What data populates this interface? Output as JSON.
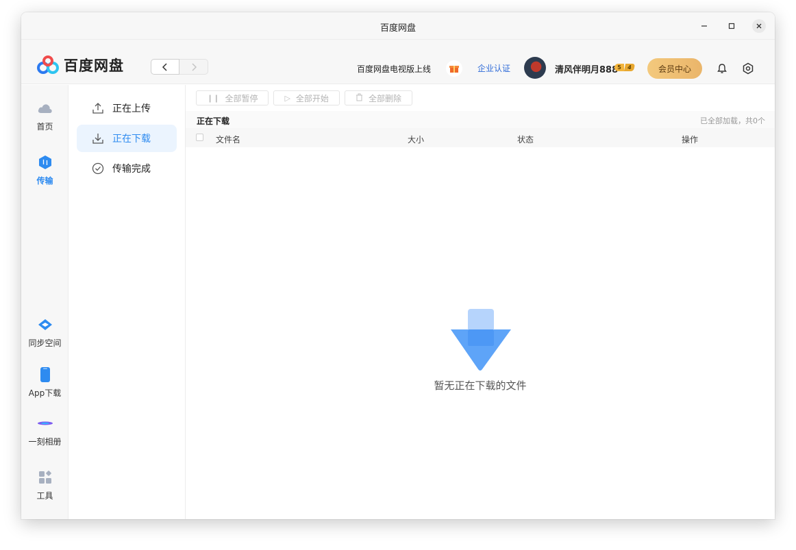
{
  "window": {
    "title": "百度网盘"
  },
  "app": {
    "name": "百度网盘"
  },
  "header": {
    "promo": "百度网盘电视版上线",
    "enterprise": "企业认证",
    "username": "清风伴明月888",
    "level_badge": [
      "5",
      "4"
    ],
    "vip_label": "会员中心"
  },
  "leftnav": {
    "home": "首页",
    "transfer": "传输",
    "sync": "同步空间",
    "app_download": "App下载",
    "album": "一刻相册",
    "tools": "工具"
  },
  "subnav": {
    "uploading": "正在上传",
    "downloading": "正在下载",
    "completed": "传输完成"
  },
  "toolbar": {
    "pause_all": "全部暂停",
    "start_all": "全部开始",
    "delete_all": "全部删除"
  },
  "section": {
    "title": "正在下载",
    "count": "已全部加载，共0个"
  },
  "table": {
    "columns": [
      "文件名",
      "大小",
      "状态",
      "操作"
    ]
  },
  "empty": {
    "message": "暂无正在下载的文件"
  },
  "colors": {
    "accent": "#2e8bf0",
    "vip": "#eab56a"
  }
}
